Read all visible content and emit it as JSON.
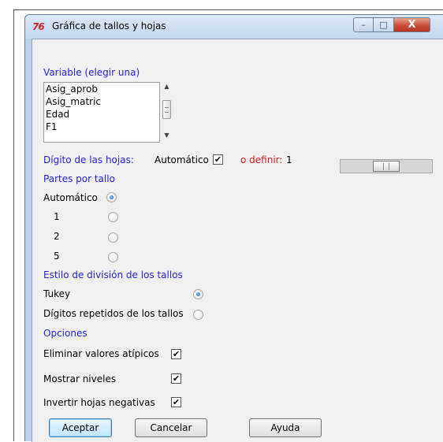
{
  "window": {
    "title": "Gráfica de tallos y hojas",
    "app_icon_text": "76",
    "buttons": {
      "minimize": "–",
      "maximize": "□",
      "close": "X"
    }
  },
  "variable": {
    "label": "Variable (elegir una)",
    "items": [
      "Asig_aprob",
      "Asig_matric",
      "Edad",
      "F1"
    ]
  },
  "leaf_digit": {
    "label": "Dígito de las hojas:",
    "auto_label": "Automático",
    "auto_checked": true,
    "define_label": "o definir:",
    "define_value": "1"
  },
  "parts_per_stem": {
    "label": "Partes por tallo",
    "options": [
      {
        "label": "Automático",
        "selected": true
      },
      {
        "label": "1",
        "selected": false
      },
      {
        "label": "2",
        "selected": false
      },
      {
        "label": "5",
        "selected": false
      }
    ]
  },
  "division_style": {
    "label": "Estilo de división de los tallos",
    "options": [
      {
        "label": "Tukey",
        "selected": true
      },
      {
        "label": "Dígitos repetidos de los tallos",
        "selected": false
      }
    ]
  },
  "options": {
    "label": "Opciones",
    "items": [
      {
        "label": "Eliminar valores atípicos",
        "checked": true
      },
      {
        "label": "Mostrar niveles",
        "checked": true
      },
      {
        "label": "Invertir hojas negativas",
        "checked": true
      }
    ]
  },
  "buttons": {
    "ok": "Aceptar",
    "cancel": "Cancelar",
    "help": "Ayuda"
  },
  "check_mark": "✔"
}
